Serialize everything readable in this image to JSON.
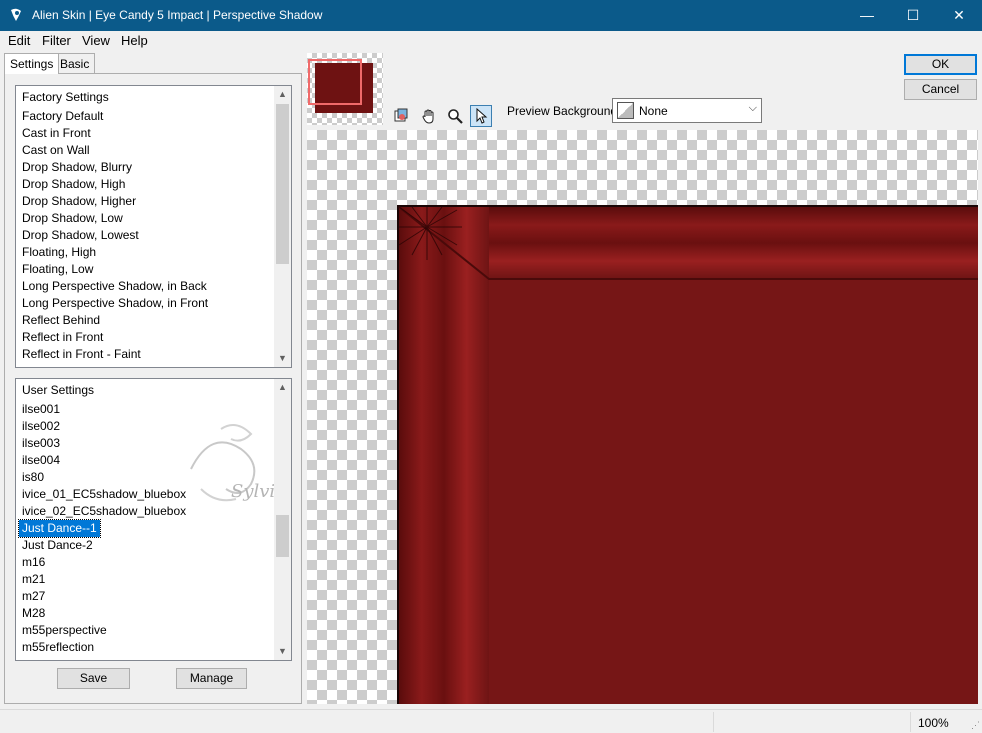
{
  "window": {
    "title": "Alien Skin | Eye Candy 5 Impact | Perspective Shadow",
    "minimize_glyph": "—",
    "maximize_glyph": "☐",
    "close_glyph": "✕"
  },
  "menu": {
    "items": [
      {
        "label": "Edit"
      },
      {
        "label": "Filter"
      },
      {
        "label": "View"
      },
      {
        "label": "Help"
      }
    ]
  },
  "tabs": [
    {
      "label": "Settings",
      "active": true
    },
    {
      "label": "Basic",
      "active": false
    }
  ],
  "factory_settings": {
    "header": "Factory Settings",
    "items": [
      "Factory Default",
      "Cast in Front",
      "Cast on Wall",
      "Drop Shadow, Blurry",
      "Drop Shadow, High",
      "Drop Shadow, Higher",
      "Drop Shadow, Low",
      "Drop Shadow, Lowest",
      "Floating, High",
      "Floating, Low",
      "Long Perspective Shadow, in Back",
      "Long Perspective Shadow, in Front",
      "Reflect Behind",
      "Reflect in Front",
      "Reflect in Front - Faint"
    ]
  },
  "user_settings": {
    "header": "User Settings",
    "items": [
      "ilse001",
      "ilse002",
      "ilse003",
      "ilse004",
      "is80",
      "ivice_01_EC5shadow_bluebox",
      "ivice_02_EC5shadow_bluebox",
      "Just Dance--1",
      "Just Dance-2",
      "m16",
      "m21",
      "m27",
      "M28",
      "m55perspective",
      "m55reflection"
    ],
    "selected": "Just Dance--1"
  },
  "buttons": {
    "save": "Save",
    "manage": "Manage",
    "ok": "OK",
    "cancel": "Cancel"
  },
  "preview": {
    "background_label": "Preview Background:",
    "background_value": "None",
    "image_color": "#7a1414",
    "frame_color": "#f06a6a"
  },
  "tools": [
    {
      "icon": "preview-toggle-icon"
    },
    {
      "icon": "hand-icon"
    },
    {
      "icon": "zoom-icon"
    },
    {
      "icon": "arrow-pointer-icon",
      "active": true
    }
  ],
  "status": {
    "zoom": "100%"
  },
  "watermark": "Sylviane",
  "colors": {
    "titlebar": "#0b5a8a",
    "selection": "#0078d7",
    "accent_button": "#0078d7"
  }
}
